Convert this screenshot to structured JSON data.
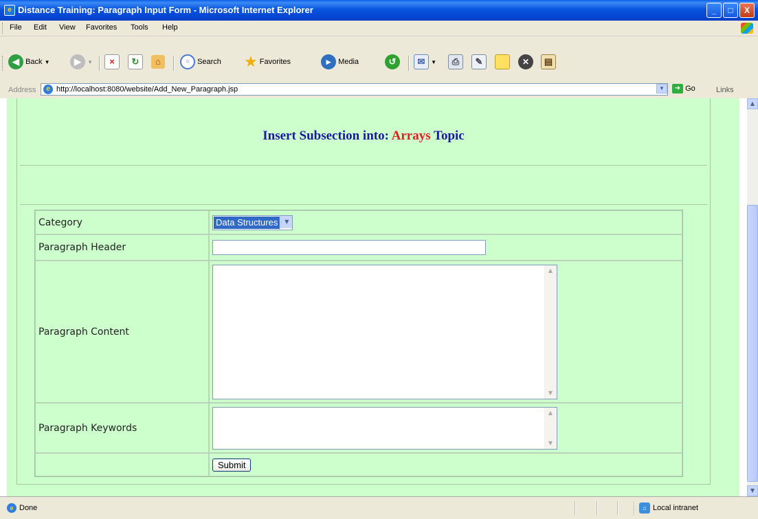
{
  "window": {
    "title": "Distance Training: Paragraph Input Form - Microsoft Internet Explorer",
    "minimize_glyph": "_",
    "maximize_glyph": "□",
    "close_glyph": "X"
  },
  "menu": {
    "items": [
      {
        "label": "File"
      },
      {
        "label": "Edit"
      },
      {
        "label": "View"
      },
      {
        "label": "Favorites"
      },
      {
        "label": "Tools"
      },
      {
        "label": "Help"
      }
    ]
  },
  "toolbar": {
    "back_label": "Back",
    "search_label": "Search",
    "favorites_label": "Favorites",
    "media_label": "Media"
  },
  "address": {
    "label": "Address",
    "url": "http://localhost:8080/website/Add_New_Paragraph.jsp",
    "go_label": "Go",
    "links_label": "Links"
  },
  "page": {
    "heading_prefix": "Insert Subsection into:",
    "heading_topic": "Arrays",
    "heading_suffix": "Topic",
    "form": {
      "category_label": "Category",
      "category_value": "Data Structures",
      "header_label": "Paragraph Header",
      "header_value": "",
      "content_label": "Paragraph Content",
      "content_value": "",
      "keywords_label": "Paragraph Keywords",
      "keywords_value": "",
      "submit_label": "Submit"
    }
  },
  "status": {
    "text": "Done",
    "zone": "Local intranet"
  },
  "colors": {
    "page_background": "#ccffcc",
    "heading_text": "#1a1aa0",
    "topic_text": "#e02020",
    "title_bar": "#0a5ce8"
  }
}
